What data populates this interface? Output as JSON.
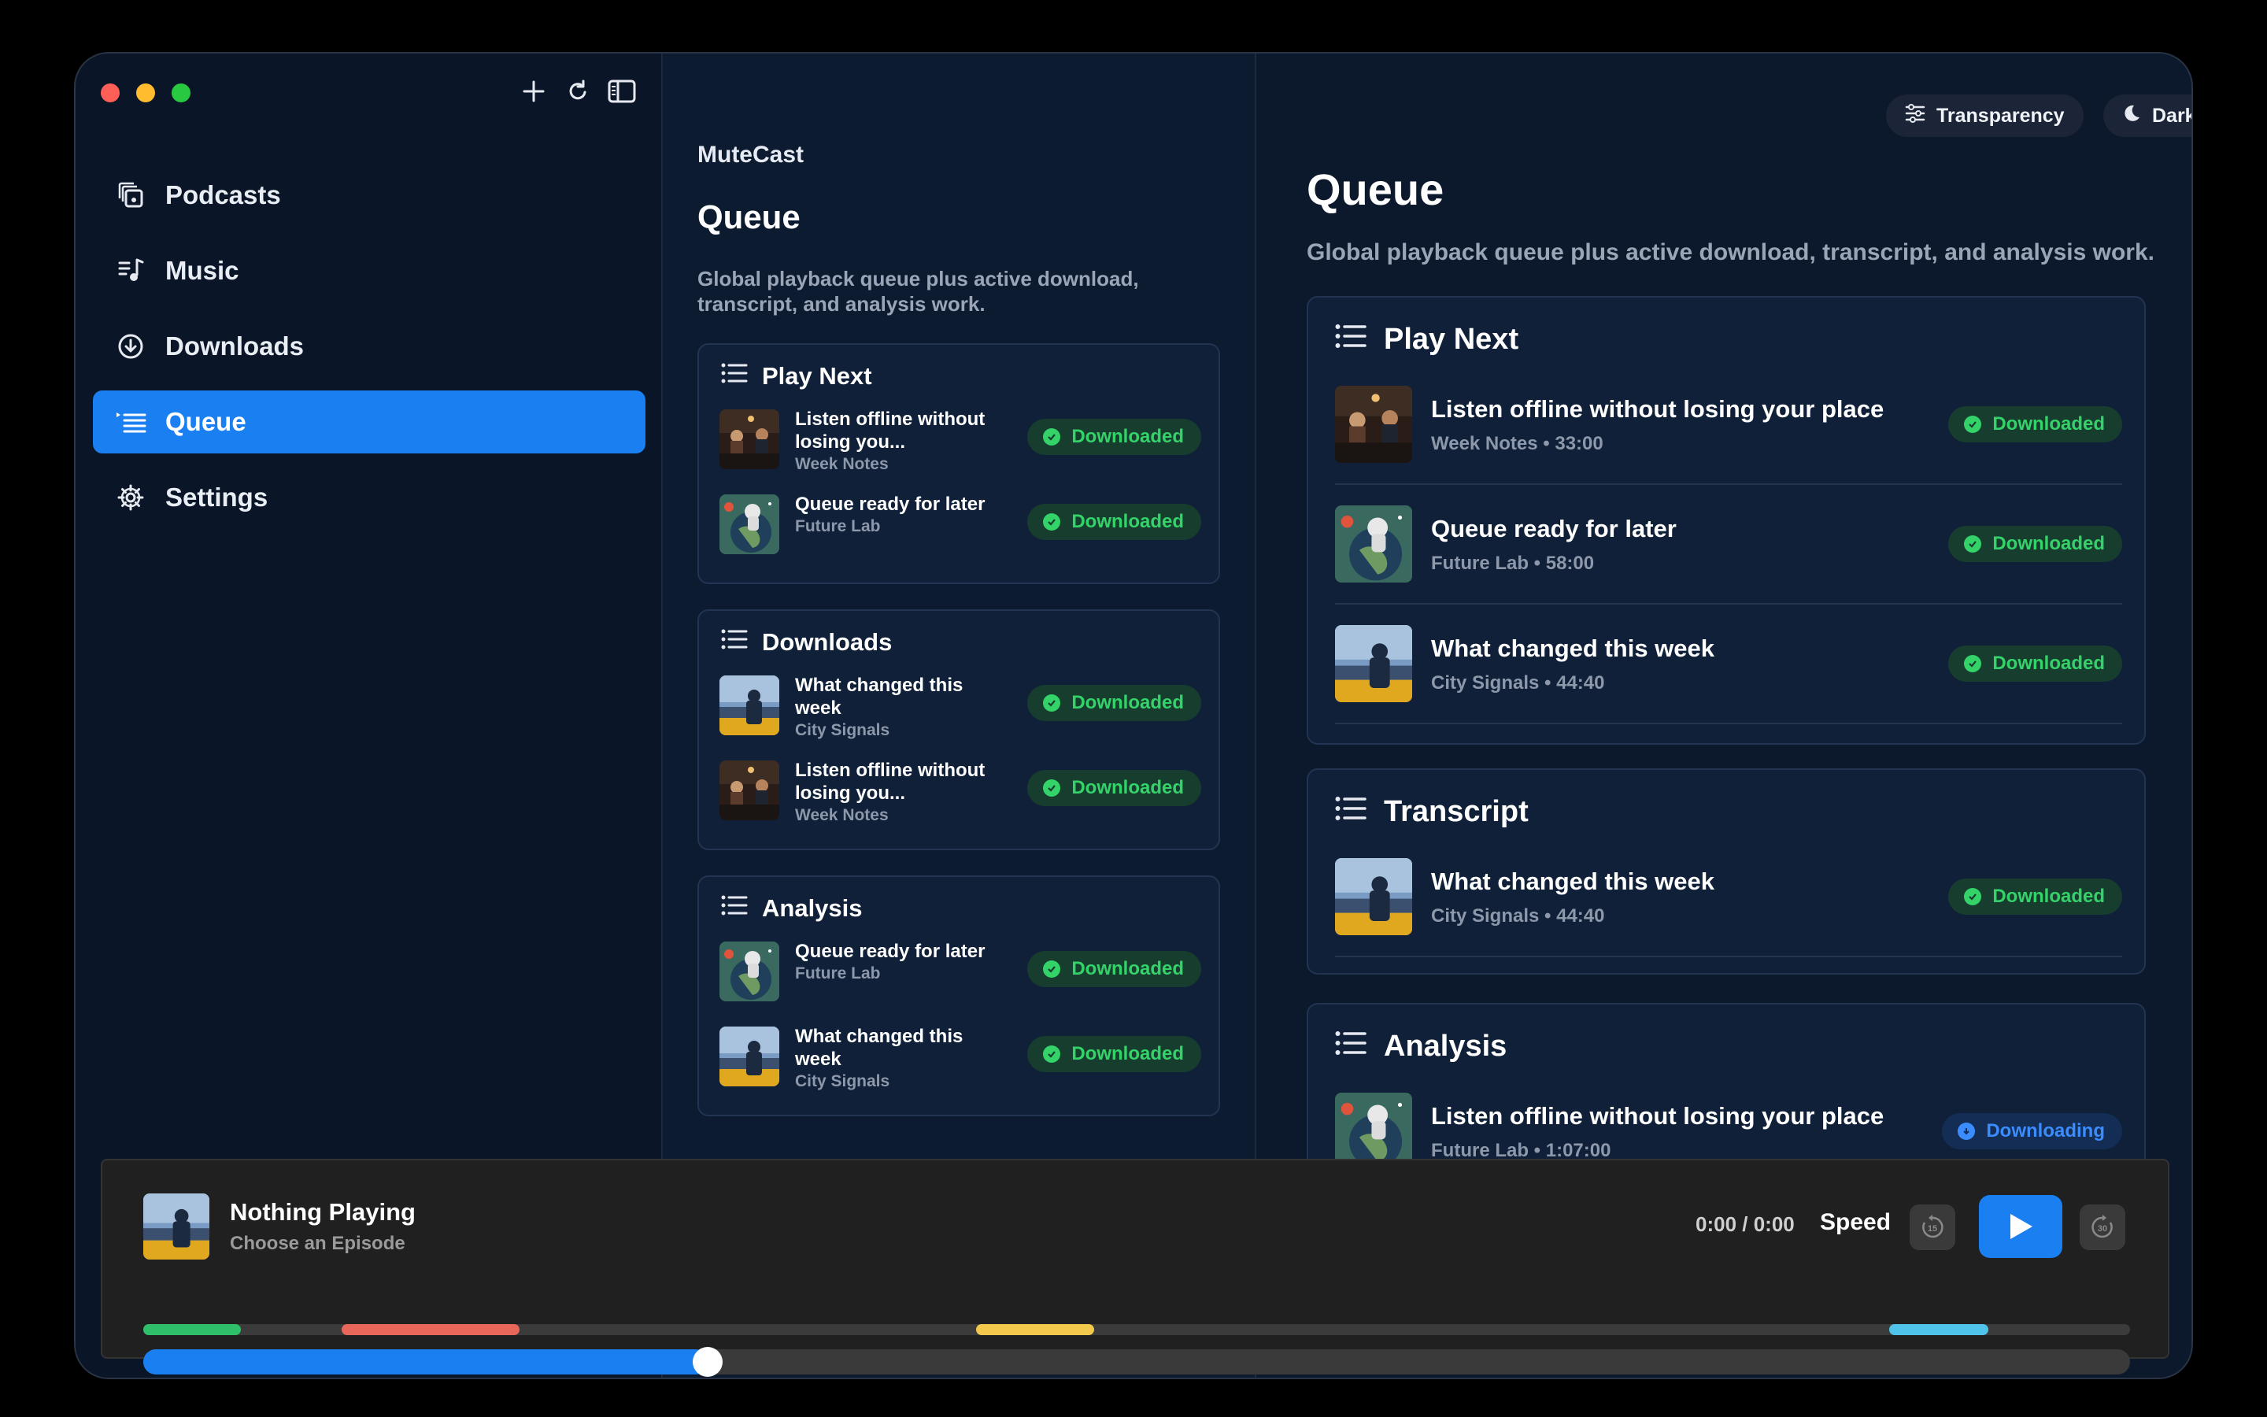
{
  "sidebar": {
    "items": [
      {
        "label": "Podcasts",
        "icon": "podcasts-icon"
      },
      {
        "label": "Music",
        "icon": "music-icon"
      },
      {
        "label": "Downloads",
        "icon": "downloads-icon"
      },
      {
        "label": "Queue",
        "icon": "queue-icon",
        "active": true
      },
      {
        "label": "Settings",
        "icon": "settings-icon"
      }
    ],
    "accent": "#1a7ff0"
  },
  "middle": {
    "app_name": "MuteCast",
    "title": "Queue",
    "subtitle": "Global playback queue plus active download, transcript, and analysis work.",
    "sections": [
      {
        "title": "Play Next",
        "rows": [
          {
            "title": "Listen offline without losing you...",
            "meta": "Week Notes",
            "status": "Downloaded"
          },
          {
            "title": "Queue ready for later",
            "meta": "Future Lab",
            "status": "Downloaded"
          }
        ]
      },
      {
        "title": "Downloads",
        "rows": [
          {
            "title": "What changed this week",
            "meta": "City Signals",
            "status": "Downloaded"
          },
          {
            "title": "Listen offline without losing you...",
            "meta": "Week Notes",
            "status": "Downloaded"
          }
        ]
      },
      {
        "title": "Analysis",
        "rows": [
          {
            "title": "Queue ready for later",
            "meta": "Future Lab",
            "status": "Downloaded"
          },
          {
            "title": "What changed this week",
            "meta": "City Signals",
            "status": "Downloaded"
          }
        ]
      }
    ]
  },
  "right": {
    "transparency_label": "Transparency",
    "theme_label": "Dark",
    "title": "Queue",
    "subtitle": "Global playback queue plus active download, transcript, and analysis work.",
    "sections": [
      {
        "title": "Play Next",
        "rows": [
          {
            "title": "Listen offline without losing your place",
            "meta": "Week Notes • 33:00",
            "status": "Downloaded"
          },
          {
            "title": "Queue ready for later",
            "meta": "Future Lab • 58:00",
            "status": "Downloaded"
          },
          {
            "title": "What changed this week",
            "meta": "City Signals • 44:40",
            "status": "Downloaded"
          }
        ]
      },
      {
        "title": "Transcript",
        "rows": [
          {
            "title": "What changed this week",
            "meta": "City Signals • 44:40",
            "status": "Downloaded"
          }
        ]
      },
      {
        "title": "Analysis",
        "rows": [
          {
            "title": "Listen offline without losing your place",
            "meta": "Future Lab • 1:07:00",
            "status": "Downloading"
          }
        ]
      }
    ]
  },
  "player": {
    "title": "Nothing Playing",
    "subtitle": "Choose an Episode",
    "time": "0:00 / 0:00",
    "speed_label": "Speed",
    "skip_back": "15",
    "skip_forward": "30",
    "progress_fraction": 0.28
  }
}
